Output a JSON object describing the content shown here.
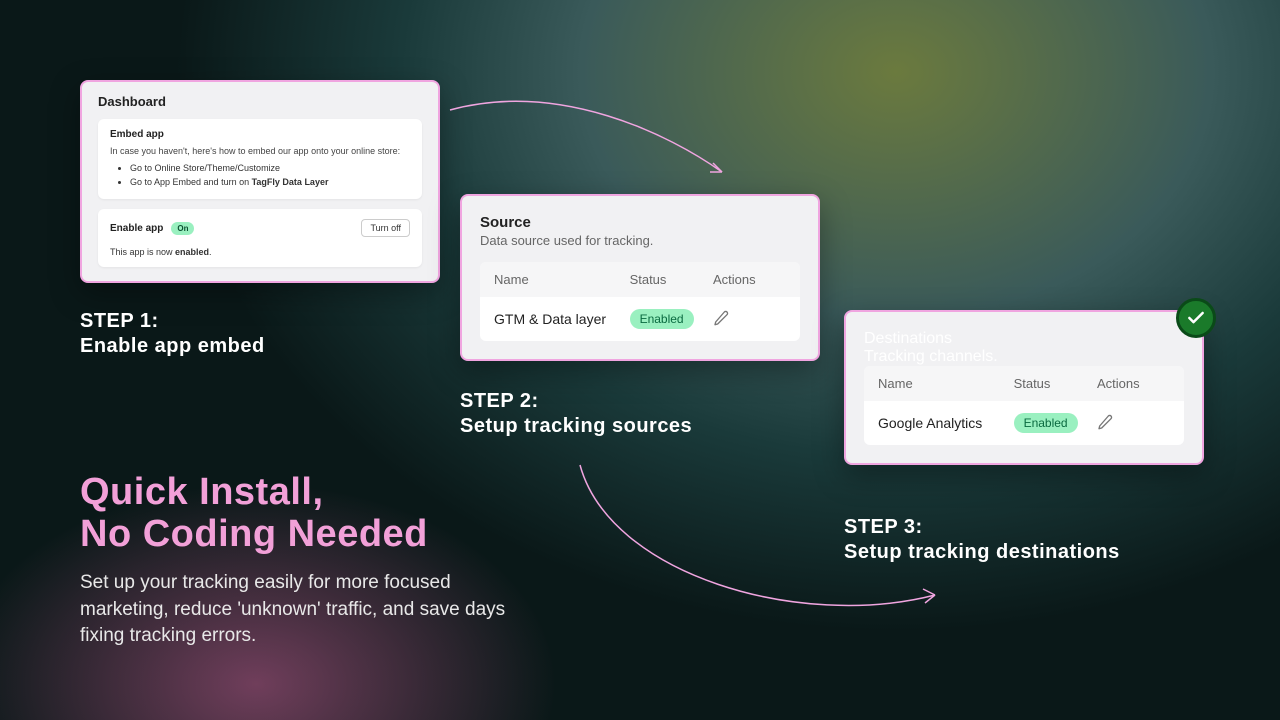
{
  "step1": {
    "label_line1": "STEP 1:",
    "label_line2": "Enable app embed",
    "card_title": "Dashboard",
    "embed": {
      "title": "Embed app",
      "desc": "In case you haven't, here's how to embed our app onto your online store:",
      "bullet1": "Go to Online Store/Theme/Customize",
      "bullet2_prefix": "Go to App Embed and turn on ",
      "bullet2_bold": "TagFly Data Layer"
    },
    "enable": {
      "title": "Enable app",
      "badge": "On",
      "turnoff": "Turn off",
      "status_prefix": "This app is now ",
      "status_bold": "enabled",
      "status_suffix": "."
    }
  },
  "step2": {
    "label_line1": "STEP 2:",
    "label_line2": "Setup tracking sources",
    "title": "Source",
    "desc": "Data source used for tracking.",
    "cols": {
      "name": "Name",
      "status": "Status",
      "actions": "Actions"
    },
    "row": {
      "name": "GTM & Data layer",
      "status": "Enabled"
    }
  },
  "step3": {
    "label_line1": "STEP 3:",
    "label_line2": "Setup tracking destinations",
    "title": "Destinations",
    "desc": "Tracking channels.",
    "cols": {
      "name": "Name",
      "status": "Status",
      "actions": "Actions"
    },
    "row": {
      "name": "Google Analytics",
      "status": "Enabled"
    }
  },
  "marketing": {
    "headline_line1": "Quick Install,",
    "headline_line2": "No Coding Needed",
    "subhead": "Set up your tracking easily for more focused marketing, reduce 'unknown' traffic, and save days fixing tracking errors."
  }
}
